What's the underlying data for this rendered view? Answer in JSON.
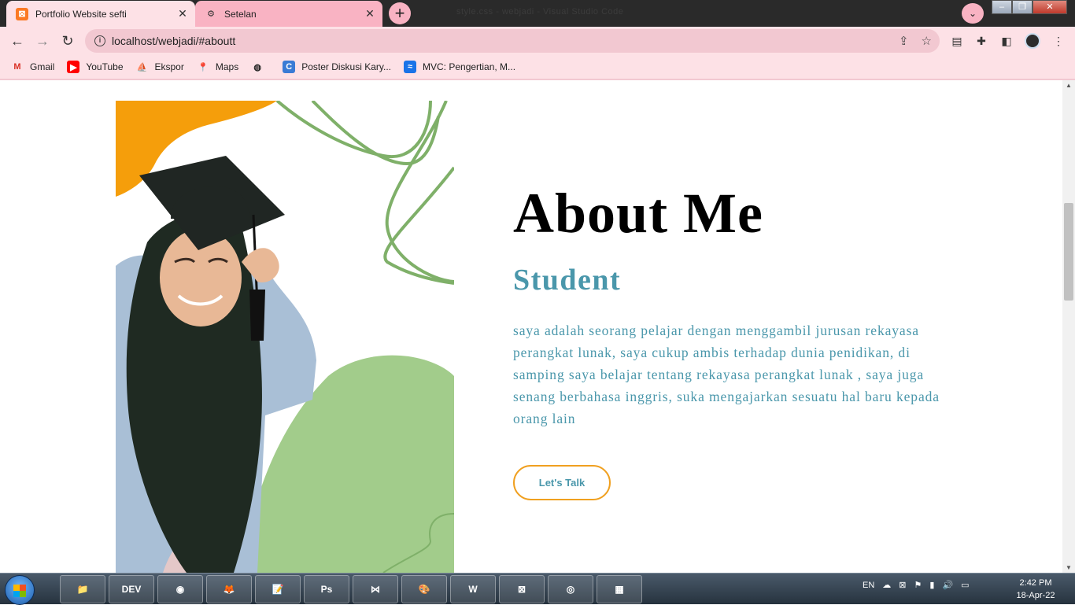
{
  "browser": {
    "tabs": [
      {
        "title": "Portfolio Website sefti",
        "active": true,
        "icon": "xampp-icon"
      },
      {
        "title": "Setelan",
        "active": false,
        "icon": "gear-icon"
      }
    ],
    "window_title": "style.css - webjadi - Visual Studio Code",
    "url": "localhost/webjadi/#aboutt",
    "bookmarks": [
      {
        "label": "Gmail",
        "icon": "gmail-icon"
      },
      {
        "label": "YouTube",
        "icon": "youtube-icon"
      },
      {
        "label": "Ekspor",
        "icon": "phpmyadmin-icon"
      },
      {
        "label": "Maps",
        "icon": "maps-icon"
      },
      {
        "label": "",
        "icon": "globe-icon"
      },
      {
        "label": "Poster Diskusi Kary...",
        "icon": "canva-icon"
      },
      {
        "label": "MVC: Pengertian, M...",
        "icon": "mvc-icon"
      }
    ]
  },
  "about": {
    "heading": "About Me",
    "role": "Student",
    "bio": "saya adalah seorang pelajar dengan menggambil jurusan rekayasa perangkat lunak, saya cukup ambis terhadap dunia penidikan, di samping saya belajar tentang rekayasa perangkat lunak , saya juga senang berbahasa inggris, suka mengajarkan sesuatu hal baru kepada orang lain",
    "cta_label": "Let's Talk",
    "colors": {
      "accent": "#4a97ab",
      "button_border": "#f0a020",
      "shape_orange": "#f59e0b",
      "shape_green": "#a2cc8b",
      "line_green": "#7fb069"
    }
  },
  "taskbar": {
    "apps": [
      "File Explorer",
      "DEV C++",
      "Chrome",
      "Firefox",
      "Notepad++",
      "Photoshop",
      "VS Code",
      "Paint",
      "WPS",
      "XAMPP",
      "Camtasia",
      "WinRAR"
    ],
    "language": "EN",
    "time": "2:42 PM",
    "date": "18-Apr-22"
  }
}
